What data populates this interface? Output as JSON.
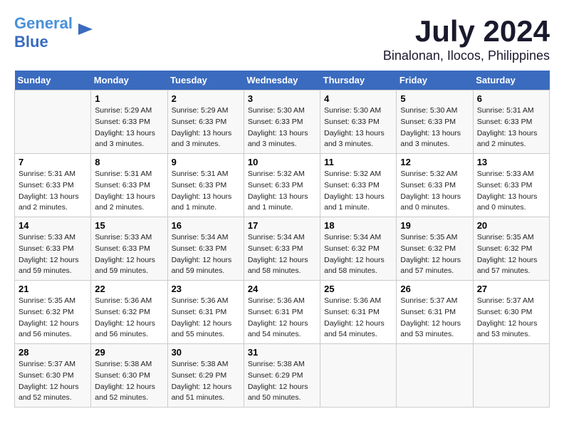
{
  "header": {
    "logo_general": "General",
    "logo_blue": "Blue",
    "title": "July 2024",
    "subtitle": "Binalonan, Ilocos, Philippines"
  },
  "columns": [
    "Sunday",
    "Monday",
    "Tuesday",
    "Wednesday",
    "Thursday",
    "Friday",
    "Saturday"
  ],
  "weeks": [
    {
      "cells": [
        {
          "day": "",
          "info": ""
        },
        {
          "day": "1",
          "info": "Sunrise: 5:29 AM\nSunset: 6:33 PM\nDaylight: 13 hours\nand 3 minutes."
        },
        {
          "day": "2",
          "info": "Sunrise: 5:29 AM\nSunset: 6:33 PM\nDaylight: 13 hours\nand 3 minutes."
        },
        {
          "day": "3",
          "info": "Sunrise: 5:30 AM\nSunset: 6:33 PM\nDaylight: 13 hours\nand 3 minutes."
        },
        {
          "day": "4",
          "info": "Sunrise: 5:30 AM\nSunset: 6:33 PM\nDaylight: 13 hours\nand 3 minutes."
        },
        {
          "day": "5",
          "info": "Sunrise: 5:30 AM\nSunset: 6:33 PM\nDaylight: 13 hours\nand 3 minutes."
        },
        {
          "day": "6",
          "info": "Sunrise: 5:31 AM\nSunset: 6:33 PM\nDaylight: 13 hours\nand 2 minutes."
        }
      ]
    },
    {
      "cells": [
        {
          "day": "7",
          "info": "Sunrise: 5:31 AM\nSunset: 6:33 PM\nDaylight: 13 hours\nand 2 minutes."
        },
        {
          "day": "8",
          "info": "Sunrise: 5:31 AM\nSunset: 6:33 PM\nDaylight: 13 hours\nand 2 minutes."
        },
        {
          "day": "9",
          "info": "Sunrise: 5:31 AM\nSunset: 6:33 PM\nDaylight: 13 hours\nand 1 minute."
        },
        {
          "day": "10",
          "info": "Sunrise: 5:32 AM\nSunset: 6:33 PM\nDaylight: 13 hours\nand 1 minute."
        },
        {
          "day": "11",
          "info": "Sunrise: 5:32 AM\nSunset: 6:33 PM\nDaylight: 13 hours\nand 1 minute."
        },
        {
          "day": "12",
          "info": "Sunrise: 5:32 AM\nSunset: 6:33 PM\nDaylight: 13 hours\nand 0 minutes."
        },
        {
          "day": "13",
          "info": "Sunrise: 5:33 AM\nSunset: 6:33 PM\nDaylight: 13 hours\nand 0 minutes."
        }
      ]
    },
    {
      "cells": [
        {
          "day": "14",
          "info": "Sunrise: 5:33 AM\nSunset: 6:33 PM\nDaylight: 12 hours\nand 59 minutes."
        },
        {
          "day": "15",
          "info": "Sunrise: 5:33 AM\nSunset: 6:33 PM\nDaylight: 12 hours\nand 59 minutes."
        },
        {
          "day": "16",
          "info": "Sunrise: 5:34 AM\nSunset: 6:33 PM\nDaylight: 12 hours\nand 59 minutes."
        },
        {
          "day": "17",
          "info": "Sunrise: 5:34 AM\nSunset: 6:33 PM\nDaylight: 12 hours\nand 58 minutes."
        },
        {
          "day": "18",
          "info": "Sunrise: 5:34 AM\nSunset: 6:32 PM\nDaylight: 12 hours\nand 58 minutes."
        },
        {
          "day": "19",
          "info": "Sunrise: 5:35 AM\nSunset: 6:32 PM\nDaylight: 12 hours\nand 57 minutes."
        },
        {
          "day": "20",
          "info": "Sunrise: 5:35 AM\nSunset: 6:32 PM\nDaylight: 12 hours\nand 57 minutes."
        }
      ]
    },
    {
      "cells": [
        {
          "day": "21",
          "info": "Sunrise: 5:35 AM\nSunset: 6:32 PM\nDaylight: 12 hours\nand 56 minutes."
        },
        {
          "day": "22",
          "info": "Sunrise: 5:36 AM\nSunset: 6:32 PM\nDaylight: 12 hours\nand 56 minutes."
        },
        {
          "day": "23",
          "info": "Sunrise: 5:36 AM\nSunset: 6:31 PM\nDaylight: 12 hours\nand 55 minutes."
        },
        {
          "day": "24",
          "info": "Sunrise: 5:36 AM\nSunset: 6:31 PM\nDaylight: 12 hours\nand 54 minutes."
        },
        {
          "day": "25",
          "info": "Sunrise: 5:36 AM\nSunset: 6:31 PM\nDaylight: 12 hours\nand 54 minutes."
        },
        {
          "day": "26",
          "info": "Sunrise: 5:37 AM\nSunset: 6:31 PM\nDaylight: 12 hours\nand 53 minutes."
        },
        {
          "day": "27",
          "info": "Sunrise: 5:37 AM\nSunset: 6:30 PM\nDaylight: 12 hours\nand 53 minutes."
        }
      ]
    },
    {
      "cells": [
        {
          "day": "28",
          "info": "Sunrise: 5:37 AM\nSunset: 6:30 PM\nDaylight: 12 hours\nand 52 minutes."
        },
        {
          "day": "29",
          "info": "Sunrise: 5:38 AM\nSunset: 6:30 PM\nDaylight: 12 hours\nand 52 minutes."
        },
        {
          "day": "30",
          "info": "Sunrise: 5:38 AM\nSunset: 6:29 PM\nDaylight: 12 hours\nand 51 minutes."
        },
        {
          "day": "31",
          "info": "Sunrise: 5:38 AM\nSunset: 6:29 PM\nDaylight: 12 hours\nand 50 minutes."
        },
        {
          "day": "",
          "info": ""
        },
        {
          "day": "",
          "info": ""
        },
        {
          "day": "",
          "info": ""
        }
      ]
    }
  ]
}
